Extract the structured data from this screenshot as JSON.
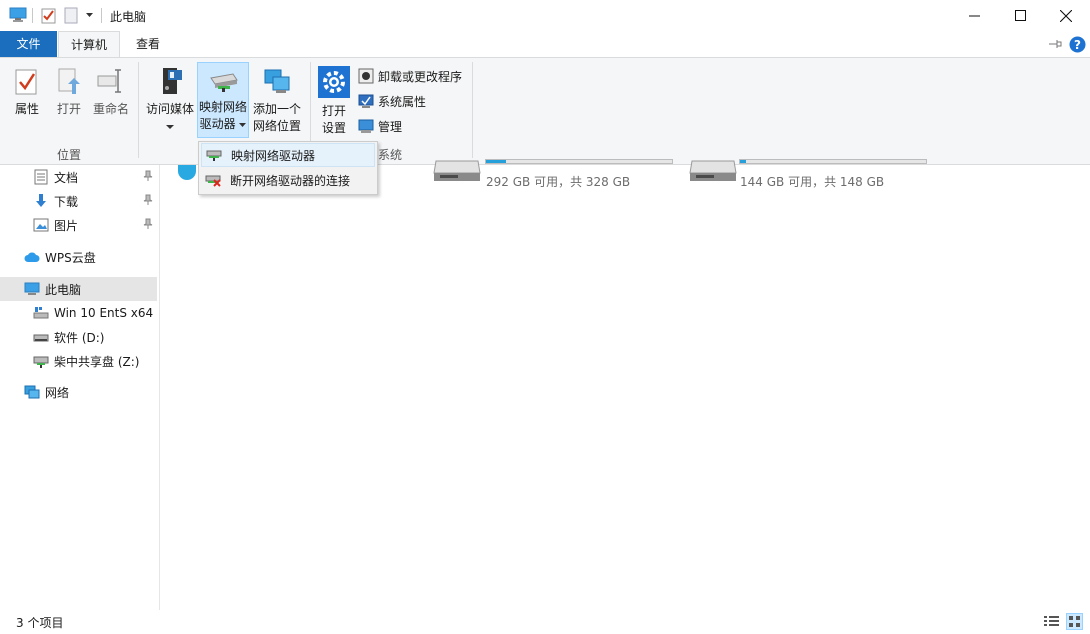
{
  "window": {
    "title": "此电脑",
    "controls": {
      "minimize": "minimize",
      "maximize": "maximize",
      "close": "close"
    }
  },
  "tabs": {
    "file": "文件",
    "computer": "计算机",
    "view": "查看"
  },
  "ribbon": {
    "location_group": {
      "label": "位置",
      "properties": "属性",
      "open": "打开",
      "rename": "重命名"
    },
    "network_group": {
      "access_media": "访问媒体",
      "map_drive_line1": "映射网络",
      "map_drive_line2": "驱动器",
      "add_location_line1": "添加一个",
      "add_location_line2": "网络位置"
    },
    "system_group": {
      "label": "系统",
      "open_settings_line1": "打开",
      "open_settings_line2": "设置",
      "uninstall": "卸载或更改程序",
      "system_properties": "系统属性",
      "manage": "管理"
    }
  },
  "dropdown": {
    "items": [
      {
        "label": "映射网络驱动器"
      },
      {
        "label": "断开网络驱动器的连接"
      }
    ]
  },
  "nav": {
    "items": [
      {
        "label": "文档",
        "icon": "document-icon"
      },
      {
        "label": "下载",
        "icon": "download-icon"
      },
      {
        "label": "图片",
        "icon": "pictures-icon"
      },
      {
        "label": "WPS云盘",
        "icon": "cloud-icon"
      },
      {
        "label": "此电脑",
        "icon": "computer-icon"
      },
      {
        "label": "Win 10 EntS x64 (",
        "icon": "system-drive-icon"
      },
      {
        "label": "软件 (D:)",
        "icon": "drive-icon"
      },
      {
        "label": "柴中共享盘 (Z:)",
        "icon": "network-drive-icon"
      },
      {
        "label": "网络",
        "icon": "network-icon"
      }
    ]
  },
  "drives": [
    {
      "free_text": "292 GB 可用，共 328 GB",
      "used_fraction": 0.11
    },
    {
      "free_text": "144 GB 可用，共 148 GB",
      "used_fraction": 0.03
    }
  ],
  "status": {
    "count": "3 个项目"
  },
  "colors": {
    "accent": "#1a6ebd",
    "help": "#1e73d2",
    "selected_nav": "#cce8ff"
  }
}
